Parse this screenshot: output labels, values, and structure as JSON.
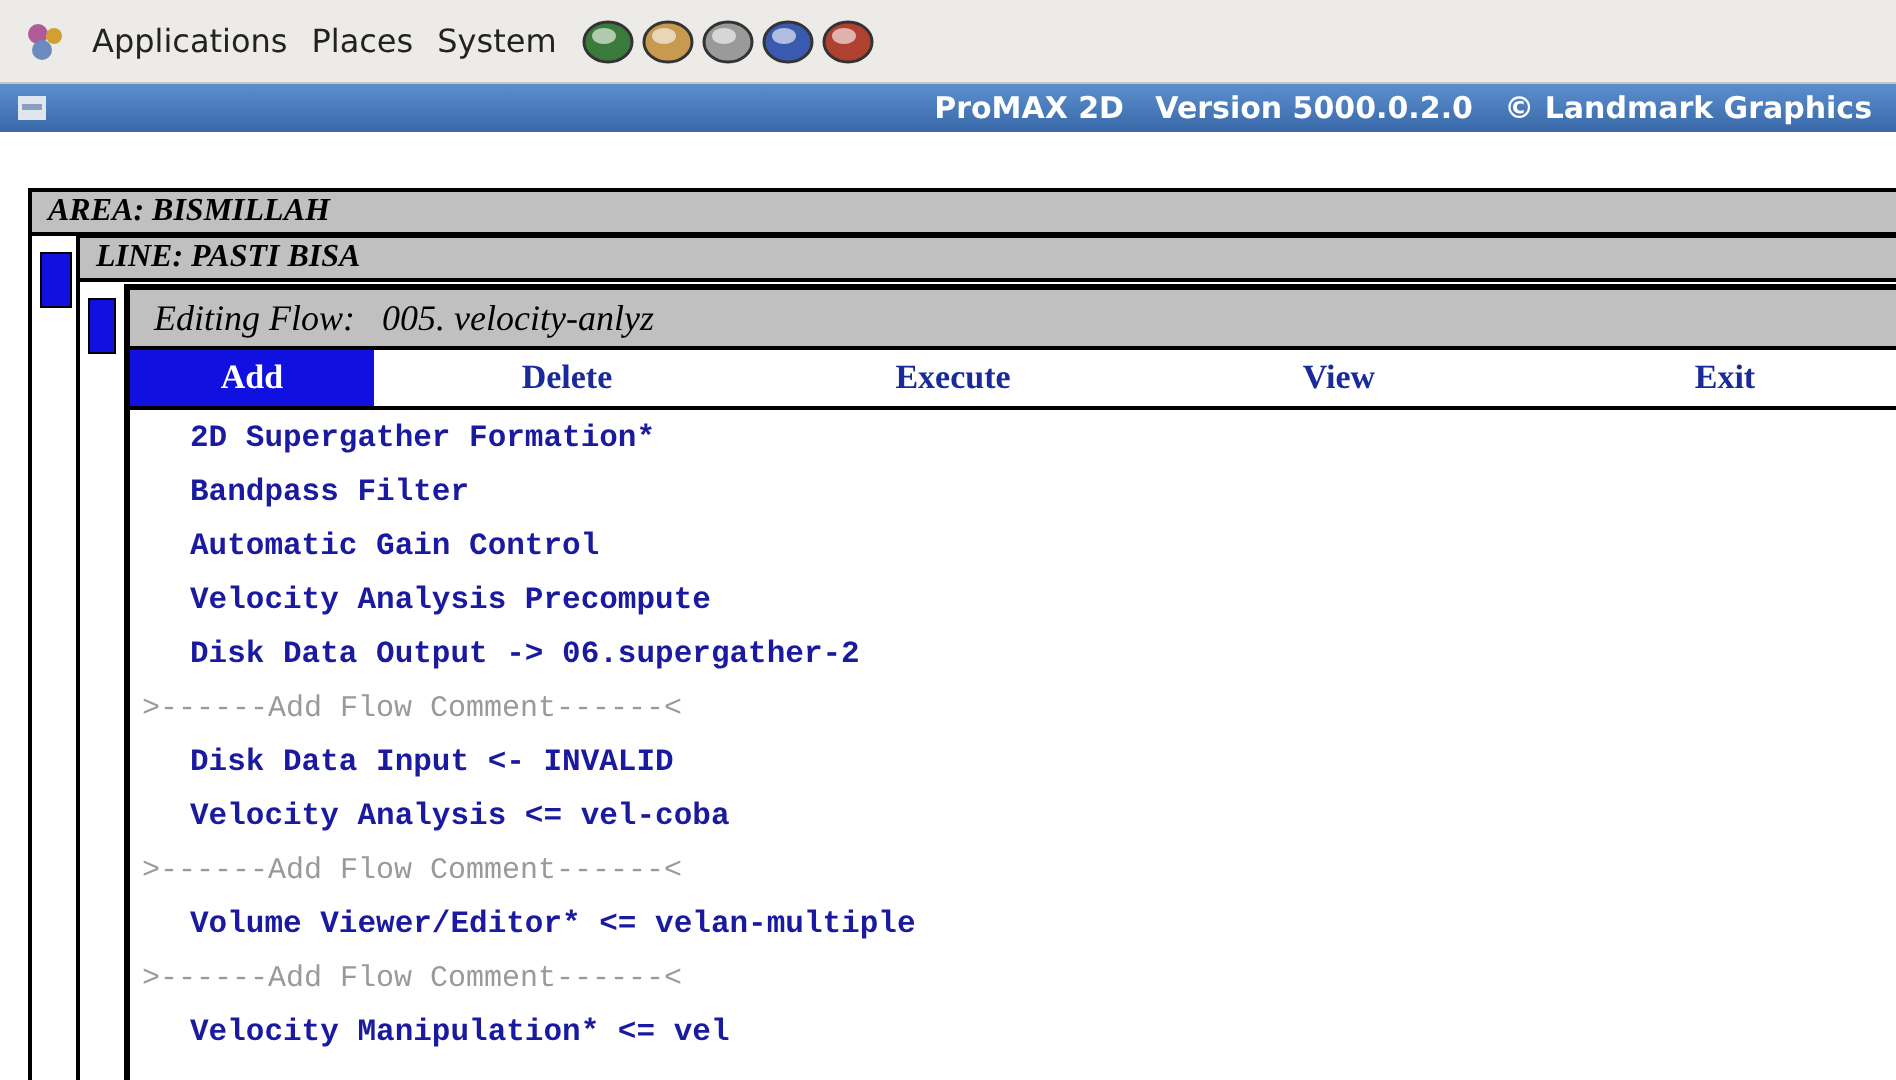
{
  "panel": {
    "menus": [
      "Applications",
      "Places",
      "System"
    ]
  },
  "titlebar": {
    "title": "ProMAX 2D   Version 5000.0.2.0   © Landmark Graphics"
  },
  "area_window": {
    "title": "AREA: BISMILLAH"
  },
  "line_window": {
    "title": "LINE: PASTI BISA"
  },
  "flow_window": {
    "title": "Editing Flow:   005. velocity-anlyz",
    "menu": [
      {
        "label": "Add",
        "selected": true
      },
      {
        "label": "Delete",
        "selected": false
      },
      {
        "label": "Execute",
        "selected": false
      },
      {
        "label": "View",
        "selected": false
      },
      {
        "label": "Exit",
        "selected": false
      }
    ],
    "items": [
      {
        "kind": "process",
        "text": "2D Supergather Formation*"
      },
      {
        "kind": "process",
        "text": "Bandpass Filter"
      },
      {
        "kind": "process",
        "text": "Automatic Gain Control"
      },
      {
        "kind": "process",
        "text": "Velocity Analysis Precompute"
      },
      {
        "kind": "process",
        "text": "Disk Data Output -> 06.supergather-2"
      },
      {
        "kind": "comment",
        "text": ">------Add Flow Comment------<"
      },
      {
        "kind": "process",
        "text": "Disk Data Input <- INVALID"
      },
      {
        "kind": "process",
        "text": "Velocity Analysis <= vel-coba"
      },
      {
        "kind": "comment",
        "text": ">------Add Flow Comment------<"
      },
      {
        "kind": "process",
        "text": "Volume Viewer/Editor* <= velan-multiple"
      },
      {
        "kind": "comment",
        "text": ">------Add Flow Comment------<"
      },
      {
        "kind": "process",
        "text": "Velocity Manipulation* <= vel"
      }
    ]
  }
}
